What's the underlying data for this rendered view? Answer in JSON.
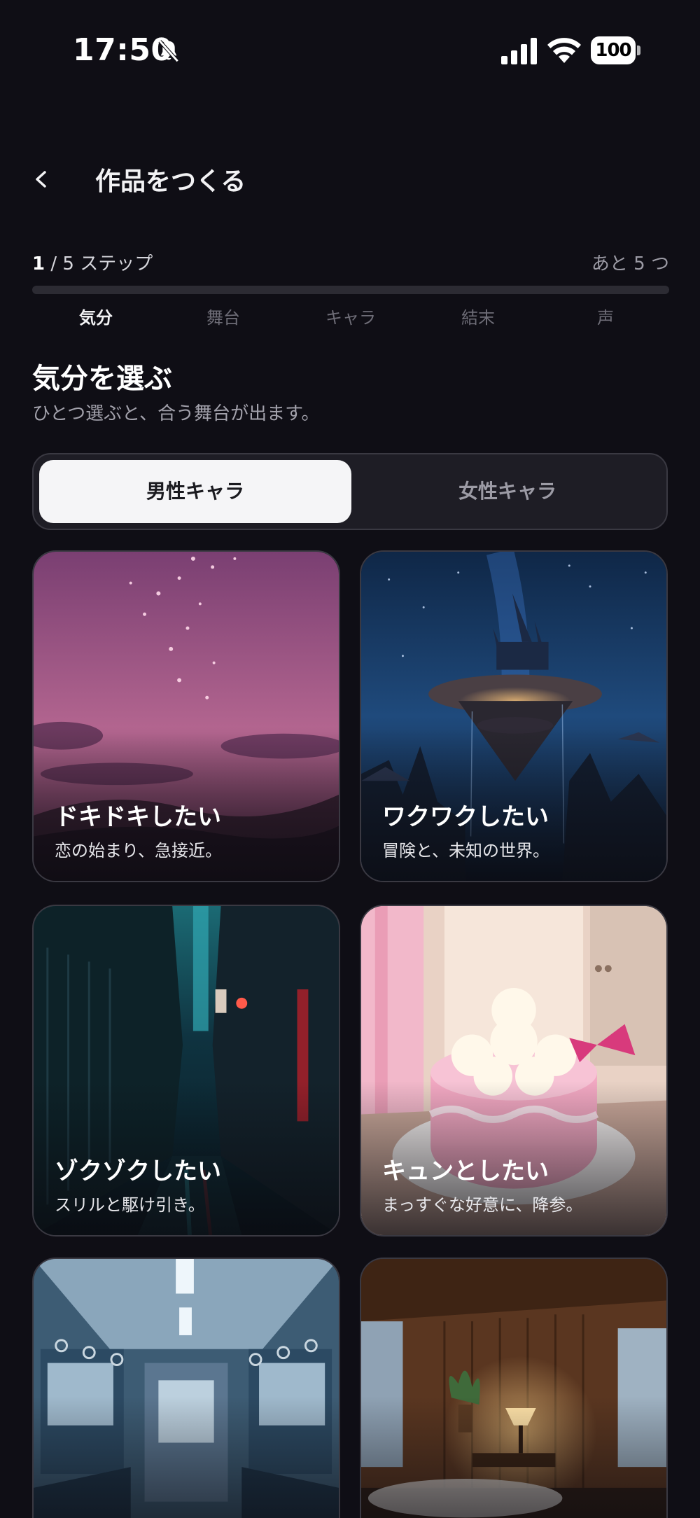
{
  "status_bar": {
    "time": "17:50",
    "battery": "100"
  },
  "header": {
    "back_icon": "chevron-left-icon",
    "title": "作品をつくる"
  },
  "progress": {
    "current": "1",
    "separator": " / ",
    "rest": "5 ステップ",
    "remaining": "あと 5 つ",
    "fraction": 0,
    "steps": [
      {
        "label": "気分",
        "active": true
      },
      {
        "label": "舞台",
        "active": false
      },
      {
        "label": "キャラ",
        "active": false
      },
      {
        "label": "結末",
        "active": false
      },
      {
        "label": "声",
        "active": false
      }
    ]
  },
  "section": {
    "title": "気分を選ぶ",
    "subtitle": "ひとつ選ぶと、合う舞台が出ます。"
  },
  "segment": {
    "male": "男性キャラ",
    "female": "女性キャラ",
    "selected": "male"
  },
  "moods": [
    {
      "title": "ドキドキしたい",
      "subtitle": "恋の始まり、急接近。"
    },
    {
      "title": "ワクワクしたい",
      "subtitle": "冒険と、未知の世界。"
    },
    {
      "title": "ゾクゾクしたい",
      "subtitle": "スリルと駆け引き。"
    },
    {
      "title": "キュンとしたい",
      "subtitle": "まっすぐな好意に、降参。"
    },
    {
      "title": "",
      "subtitle": ""
    },
    {
      "title": "",
      "subtitle": ""
    }
  ],
  "colors": {
    "background": "#0f0e15",
    "surface": "#1e1d25",
    "accent": "#f5f5f7"
  }
}
